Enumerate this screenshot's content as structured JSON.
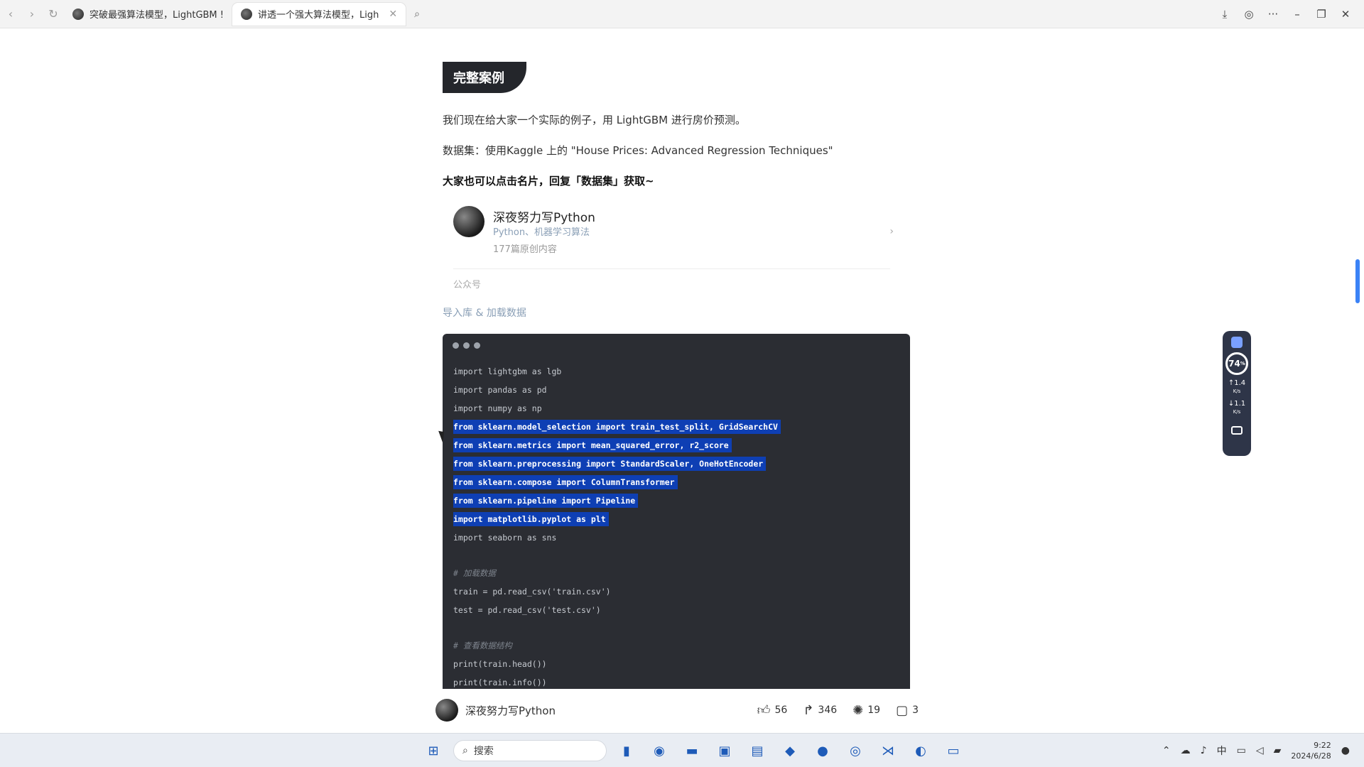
{
  "browser": {
    "tabs": [
      {
        "title": "突破最强算法模型，LightGBM !",
        "active": false
      },
      {
        "title": "讲透一个强大算法模型，Ligh",
        "active": true
      }
    ],
    "nav": {
      "back": "‹",
      "forward": "›",
      "reload": "↻"
    },
    "search_icon": "search-icon",
    "window": {
      "download": "⤓",
      "globe": "◎",
      "more": "···",
      "minimize": "–",
      "restore": "❐",
      "close": "✕"
    }
  },
  "article": {
    "section_title": "完整案例",
    "intro": "我们现在给大家一个实际的例子，用 LightGBM 进行房价预测。",
    "dataset": "数据集：使用Kaggle 上的 \"House Prices: Advanced Regression Techniques\"",
    "get_data": "大家也可以点击名片，回复「数据集」获取~",
    "card": {
      "name": "深夜努力写Python",
      "tags": "Python、机器学习算法",
      "count": "177篇原创内容",
      "type": "公众号"
    },
    "subheading": "导入库 & 加载数据",
    "code_lines": [
      {
        "text": "import lightgbm as lgb",
        "hl": false
      },
      {
        "text": "import pandas as pd",
        "hl": false
      },
      {
        "text": "import numpy as np",
        "hl": false
      },
      {
        "text": "from sklearn.model_selection import train_test_split, GridSearchCV",
        "hl": true
      },
      {
        "text": "from sklearn.metrics import mean_squared_error, r2_score",
        "hl": true
      },
      {
        "text": "from sklearn.preprocessing import StandardScaler, OneHotEncoder",
        "hl": true
      },
      {
        "text": "from sklearn.compose import ColumnTransformer",
        "hl": true
      },
      {
        "text": "from sklearn.pipeline import Pipeline",
        "hl": true
      },
      {
        "text": "import matplotlib.pyplot as plt",
        "hl": true
      },
      {
        "text": "import seaborn as sns",
        "hl": false
      }
    ],
    "code_lines_2": [
      {
        "text": "# 加载数据",
        "kind": "comment"
      },
      {
        "text": "train = pd.read_csv('train.csv')",
        "kind": "code"
      },
      {
        "text": "test = pd.read_csv('test.csv')",
        "kind": "code"
      }
    ],
    "code_lines_3": [
      {
        "text": "# 查看数据结构",
        "kind": "comment"
      },
      {
        "text": "print(train.head())",
        "kind": "code"
      },
      {
        "text": "print(train.info())",
        "kind": "code"
      }
    ]
  },
  "actionbar": {
    "author": "深夜努力写Python",
    "likes": "56",
    "shares": "346",
    "favorites": "19",
    "comments": "3"
  },
  "monitor": {
    "percent": "74",
    "percent_unit": "%",
    "up": "1.4",
    "down": "1.1",
    "unit": "K/s"
  },
  "taskbar": {
    "search_label": "搜索",
    "ime": "中",
    "time": "9:22",
    "date": "2024/6/28"
  }
}
